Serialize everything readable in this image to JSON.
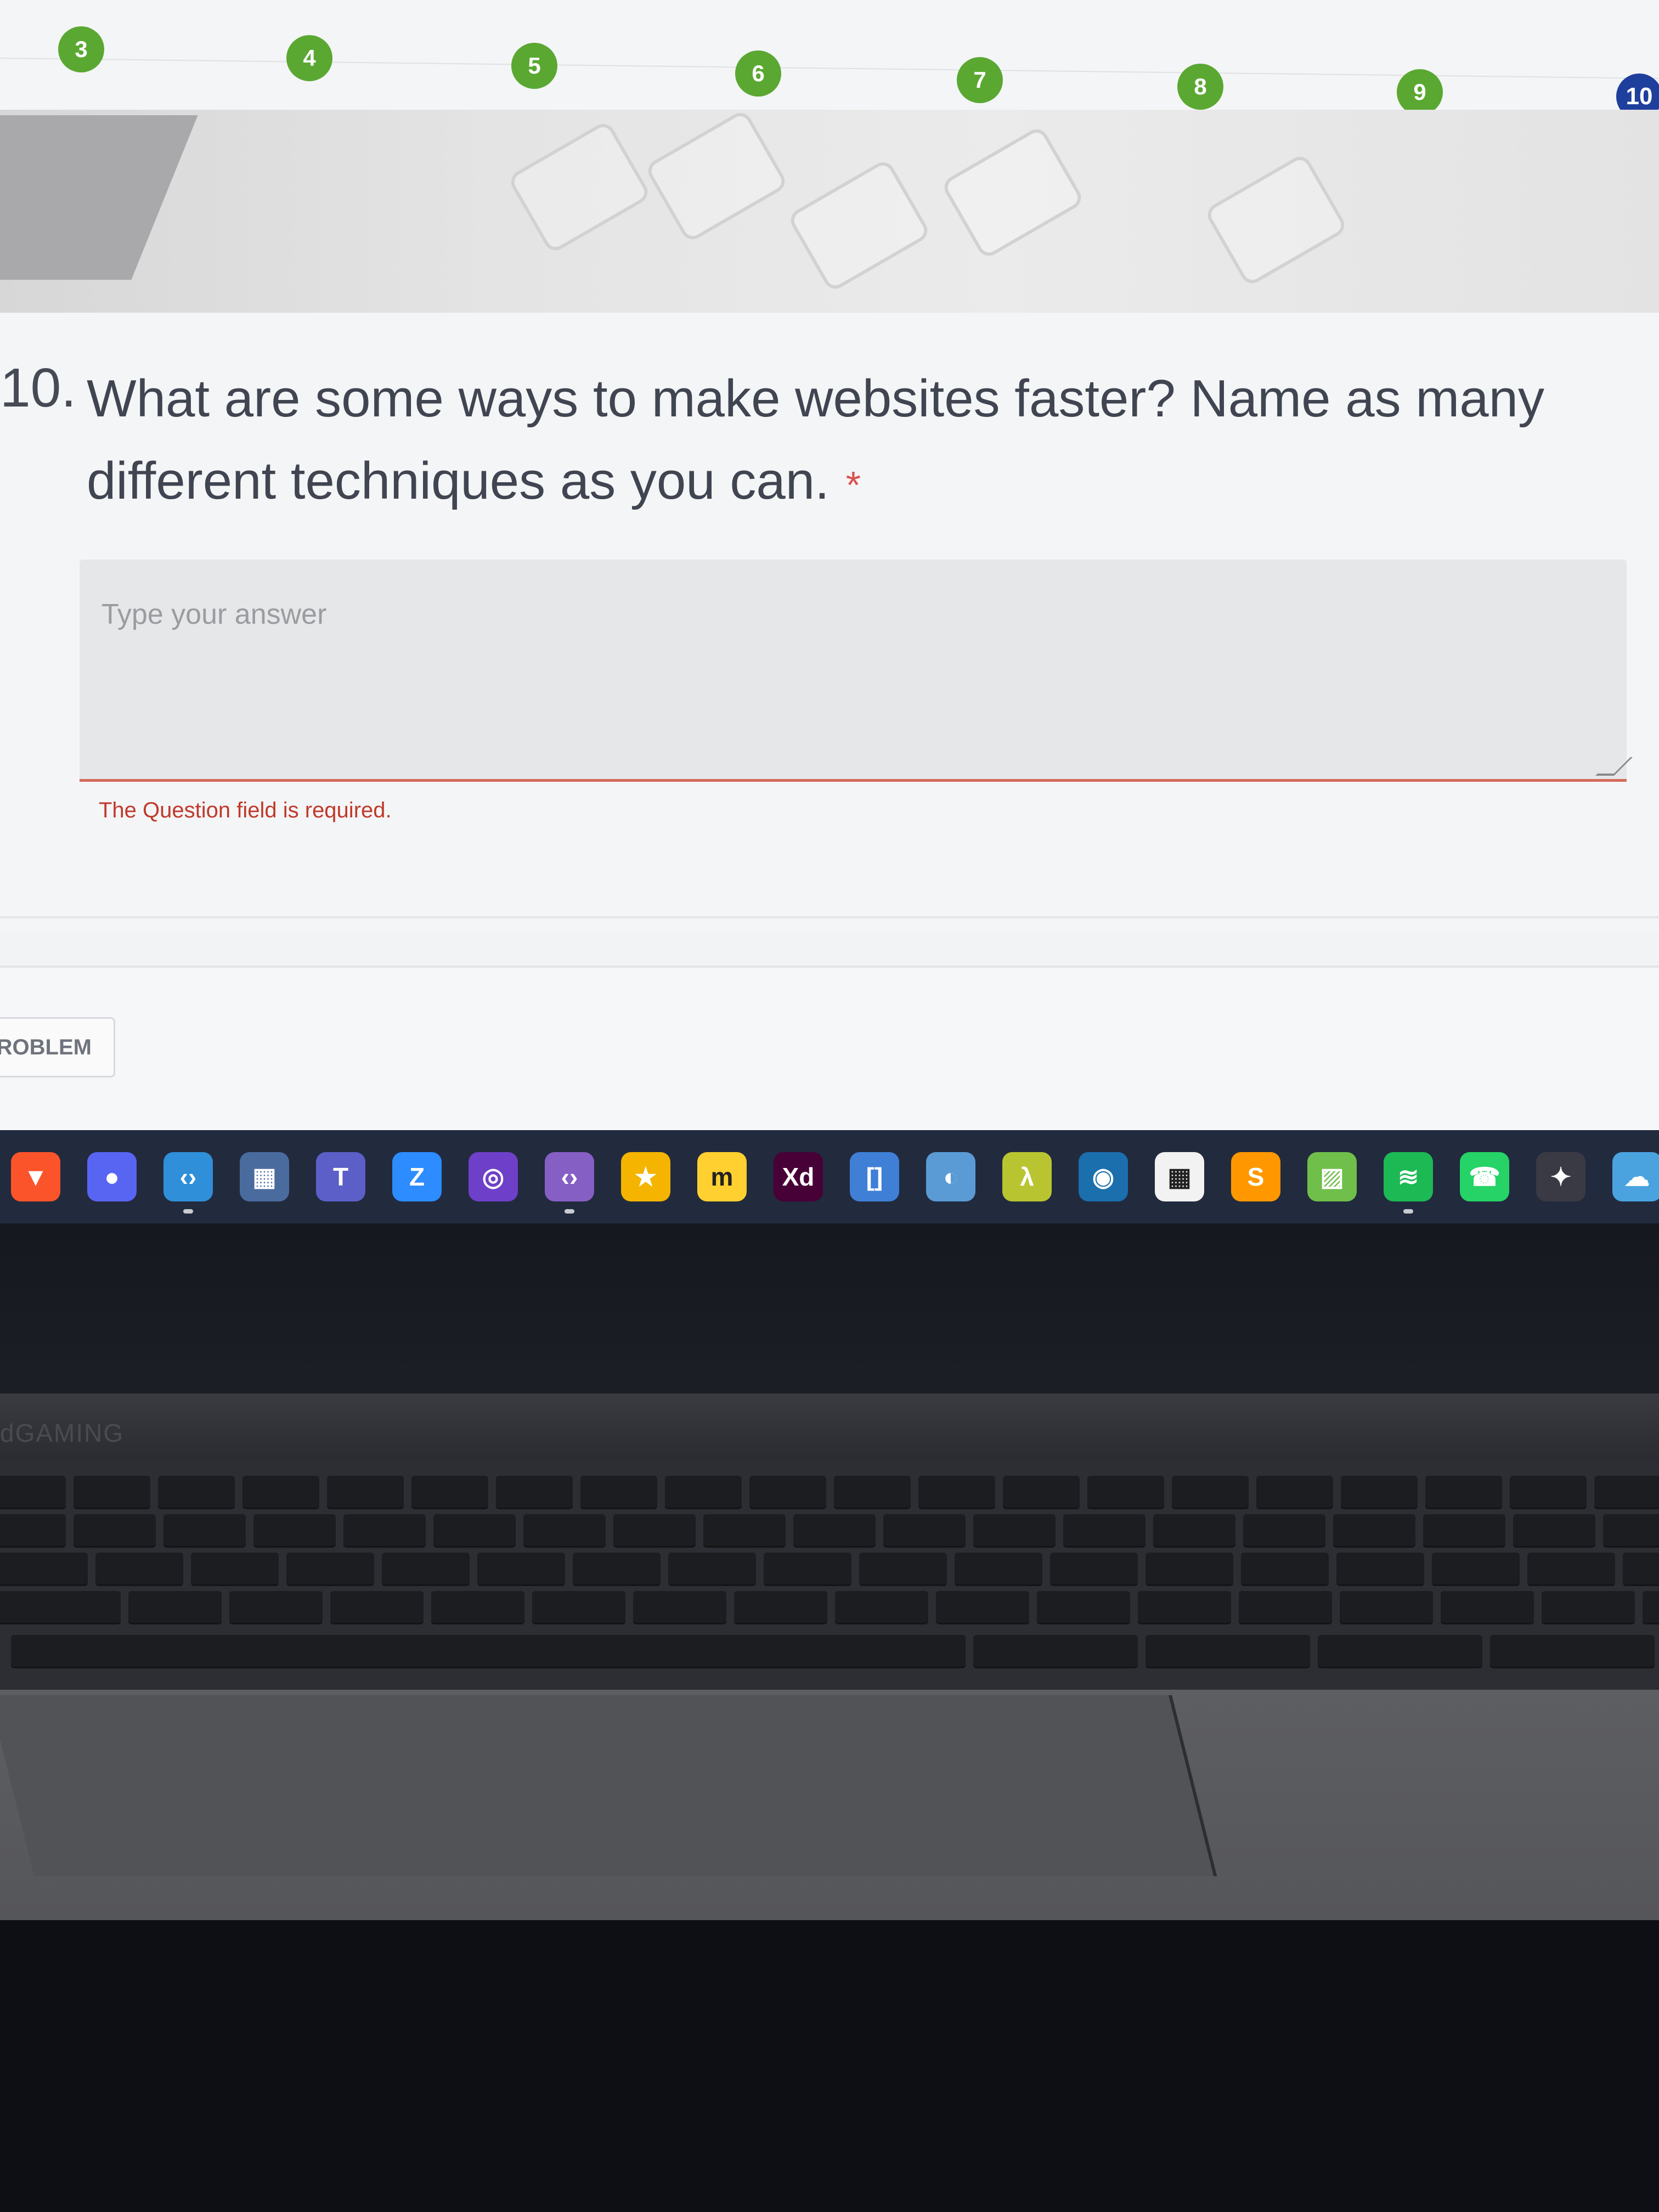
{
  "progress": {
    "steps": [
      "3",
      "4",
      "5",
      "6",
      "7",
      "8",
      "9",
      "10"
    ],
    "current_step": "10"
  },
  "question": {
    "number": "10.",
    "text": "What are some ways to make websites faster? Name as many different techniques as you can.",
    "required_mark": "*",
    "answer_placeholder": "Type your answer",
    "answer_value": "",
    "error_message": "The Question field is required."
  },
  "report": {
    "button_label": "ROBLEM"
  },
  "taskbar": {
    "icons": [
      {
        "name": "brave-icon",
        "color": "#fb542b",
        "glyph": "▼"
      },
      {
        "name": "discord-icon",
        "color": "#5865f2",
        "glyph": "●"
      },
      {
        "name": "vscode-icon",
        "color": "#2f8fd8",
        "glyph": "‹›"
      },
      {
        "name": "calculator-icon",
        "color": "#4a6b9e",
        "glyph": "▦"
      },
      {
        "name": "teams-icon",
        "color": "#5b5fc7",
        "glyph": "T"
      },
      {
        "name": "zoom-icon",
        "color": "#2d8cff",
        "glyph": "Z"
      },
      {
        "name": "github-desktop-icon",
        "color": "#6e40c9",
        "glyph": "◎"
      },
      {
        "name": "visual-studio-icon",
        "color": "#865fc5",
        "glyph": "‹›"
      },
      {
        "name": "star-app-icon",
        "color": "#f4b400",
        "glyph": "★"
      },
      {
        "name": "miro-icon",
        "color": "#ffd02f",
        "glyph": "m"
      },
      {
        "name": "adobe-xd-icon",
        "color": "#470137",
        "glyph": "Xd"
      },
      {
        "name": "bracket-app-icon",
        "color": "#3f7fd6",
        "glyph": "[]"
      },
      {
        "name": "cycle-app-icon",
        "color": "#5a9bd5",
        "glyph": "◐"
      },
      {
        "name": "lambda-app-icon",
        "color": "#b8c531",
        "glyph": "λ"
      },
      {
        "name": "steam-icon",
        "color": "#1b6fad",
        "glyph": "◉"
      },
      {
        "name": "microsoft-store-icon",
        "color": "#f2f2f2",
        "glyph": "▦"
      },
      {
        "name": "sublime-text-icon",
        "color": "#ff9800",
        "glyph": "S"
      },
      {
        "name": "image-editor-icon",
        "color": "#6fbf4a",
        "glyph": "▨"
      },
      {
        "name": "spotify-icon",
        "color": "#1db954",
        "glyph": "≋"
      },
      {
        "name": "whatsapp-icon",
        "color": "#25d366",
        "glyph": "☎"
      },
      {
        "name": "davinci-resolve-icon",
        "color": "#3a3a44",
        "glyph": "✦"
      },
      {
        "name": "cloud-app-icon",
        "color": "#4aa3df",
        "glyph": "☁"
      }
    ]
  },
  "laptop": {
    "brand_text": "dGAMING"
  }
}
